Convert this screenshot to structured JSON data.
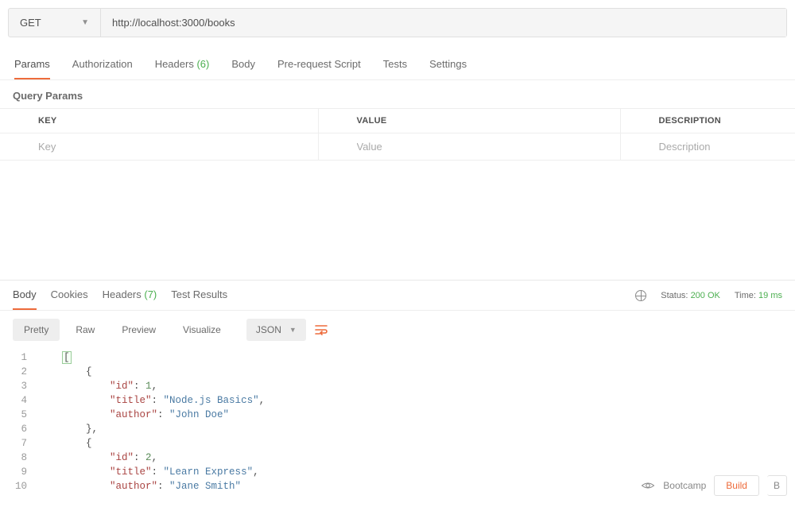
{
  "request": {
    "method": "GET",
    "url": "http://localhost:3000/books"
  },
  "reqTabs": {
    "params": "Params",
    "auth": "Authorization",
    "headers_label": "Headers",
    "headers_count": "(6)",
    "body": "Body",
    "prereq": "Pre-request Script",
    "tests": "Tests",
    "settings": "Settings"
  },
  "queryParams": {
    "header": "Query Params",
    "cols": {
      "key": "KEY",
      "value": "VALUE",
      "desc": "DESCRIPTION"
    },
    "placeholders": {
      "key": "Key",
      "value": "Value",
      "desc": "Description"
    }
  },
  "respTabs": {
    "body": "Body",
    "cookies": "Cookies",
    "headers_label": "Headers",
    "headers_count": "(7)",
    "tests": "Test Results"
  },
  "respMeta": {
    "status_label": "Status:",
    "status_value": "200 OK",
    "time_label": "Time:",
    "time_value": "19 ms"
  },
  "respToolbar": {
    "pretty": "Pretty",
    "raw": "Raw",
    "preview": "Preview",
    "visualize": "Visualize",
    "format": "JSON"
  },
  "code": {
    "lines": [
      {
        "n": 1,
        "tokens": [
          [
            "pre",
            "    "
          ],
          [
            "caret",
            "["
          ]
        ]
      },
      {
        "n": 2,
        "tokens": [
          [
            "pre",
            "        "
          ],
          [
            "punc",
            "{"
          ]
        ]
      },
      {
        "n": 3,
        "tokens": [
          [
            "pre",
            "            "
          ],
          [
            "key",
            "\"id\""
          ],
          [
            "punc",
            ": "
          ],
          [
            "num",
            "1"
          ],
          [
            "punc",
            ","
          ]
        ]
      },
      {
        "n": 4,
        "tokens": [
          [
            "pre",
            "            "
          ],
          [
            "key",
            "\"title\""
          ],
          [
            "punc",
            ": "
          ],
          [
            "str",
            "\"Node.js Basics\""
          ],
          [
            "punc",
            ","
          ]
        ]
      },
      {
        "n": 5,
        "tokens": [
          [
            "pre",
            "            "
          ],
          [
            "key",
            "\"author\""
          ],
          [
            "punc",
            ": "
          ],
          [
            "str",
            "\"John Doe\""
          ]
        ]
      },
      {
        "n": 6,
        "tokens": [
          [
            "pre",
            "        "
          ],
          [
            "punc",
            "},"
          ]
        ]
      },
      {
        "n": 7,
        "tokens": [
          [
            "pre",
            "        "
          ],
          [
            "punc",
            "{"
          ]
        ]
      },
      {
        "n": 8,
        "tokens": [
          [
            "pre",
            "            "
          ],
          [
            "key",
            "\"id\""
          ],
          [
            "punc",
            ": "
          ],
          [
            "num",
            "2"
          ],
          [
            "punc",
            ","
          ]
        ]
      },
      {
        "n": 9,
        "tokens": [
          [
            "pre",
            "            "
          ],
          [
            "key",
            "\"title\""
          ],
          [
            "punc",
            ": "
          ],
          [
            "str",
            "\"Learn Express\""
          ],
          [
            "punc",
            ","
          ]
        ]
      },
      {
        "n": 10,
        "tokens": [
          [
            "pre",
            "            "
          ],
          [
            "key",
            "\"author\""
          ],
          [
            "punc",
            ": "
          ],
          [
            "str",
            "\"Jane Smith\""
          ]
        ]
      }
    ]
  },
  "footer": {
    "bootcamp": "Bootcamp",
    "build": "Build",
    "other": "B"
  }
}
